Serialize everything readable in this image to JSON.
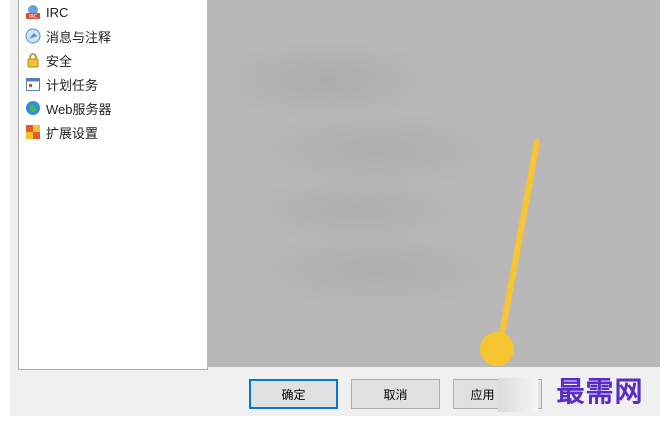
{
  "tree": {
    "items": [
      {
        "label": "IRC",
        "icon": "irc-icon"
      },
      {
        "label": "消息与注释",
        "icon": "message-icon"
      },
      {
        "label": "安全",
        "icon": "lock-icon"
      },
      {
        "label": "计划任务",
        "icon": "calendar-icon"
      },
      {
        "label": "Web服务器",
        "icon": "globe-icon"
      },
      {
        "label": "扩展设置",
        "icon": "puzzle-icon"
      }
    ]
  },
  "buttons": {
    "ok": "确定",
    "cancel": "取消",
    "apply": "应用"
  },
  "watermark": "最需网",
  "colors": {
    "annotation": "#f7c531",
    "watermark": "#5a2bc9",
    "content_bg": "#b8b8b8"
  }
}
